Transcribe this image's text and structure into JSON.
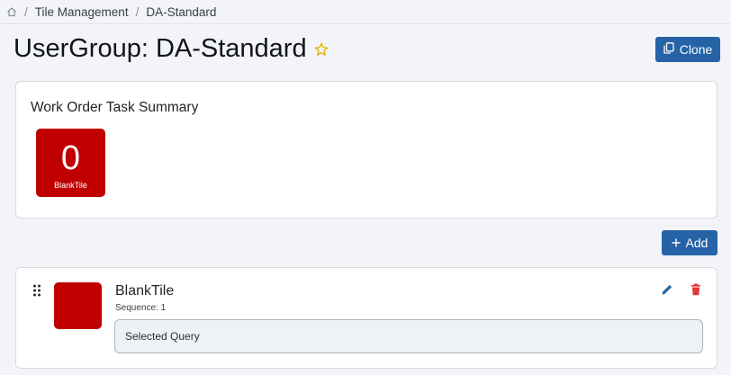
{
  "breadcrumb": {
    "icon": "home-icon",
    "items": [
      "Tile Management",
      "DA-Standard"
    ],
    "separator": "/"
  },
  "header": {
    "title": "UserGroup: DA-Standard",
    "star_icon": "star-outline-icon",
    "clone_label": "Clone",
    "clone_icon": "copy-icon"
  },
  "summary": {
    "title": "Work Order Task Summary",
    "tiles": [
      {
        "count": "0",
        "label": "BlankTile",
        "color": "#c00000"
      }
    ]
  },
  "actions": {
    "add_label": "Add",
    "add_icon": "plus-icon"
  },
  "items": [
    {
      "name": "BlankTile",
      "sequence": "Sequence: 1",
      "query_label": "Selected Query",
      "color": "#c00000",
      "edit_icon": "pencil-icon",
      "delete_icon": "trash-icon",
      "drag_icon": "drag-handle-icon"
    }
  ],
  "colors": {
    "accent": "#2563a6",
    "tile": "#c00000",
    "danger": "#e03535"
  }
}
